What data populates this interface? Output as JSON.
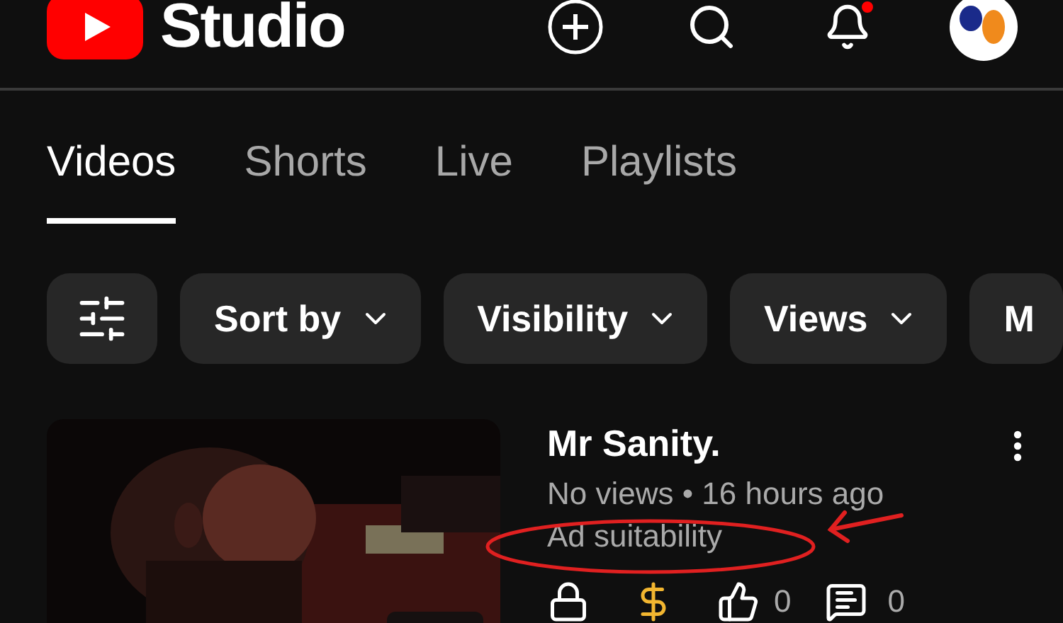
{
  "header": {
    "logo_text": "Studio",
    "notification_badge": true
  },
  "tabs": [
    {
      "label": "Videos",
      "selected": true
    },
    {
      "label": "Shorts",
      "selected": false
    },
    {
      "label": "Live",
      "selected": false
    },
    {
      "label": "Playlists",
      "selected": false
    }
  ],
  "filters": [
    {
      "label": "Sort by",
      "dropdown": true
    },
    {
      "label": "Visibility",
      "dropdown": true
    },
    {
      "label": "Views",
      "dropdown": true
    },
    {
      "label": "M",
      "dropdown": false
    }
  ],
  "videos": [
    {
      "title": "Mr Sanity.",
      "meta": "No views • 16 hours ago",
      "ad_status": "Ad suitability",
      "likes": "0",
      "comments": "0"
    }
  ]
}
